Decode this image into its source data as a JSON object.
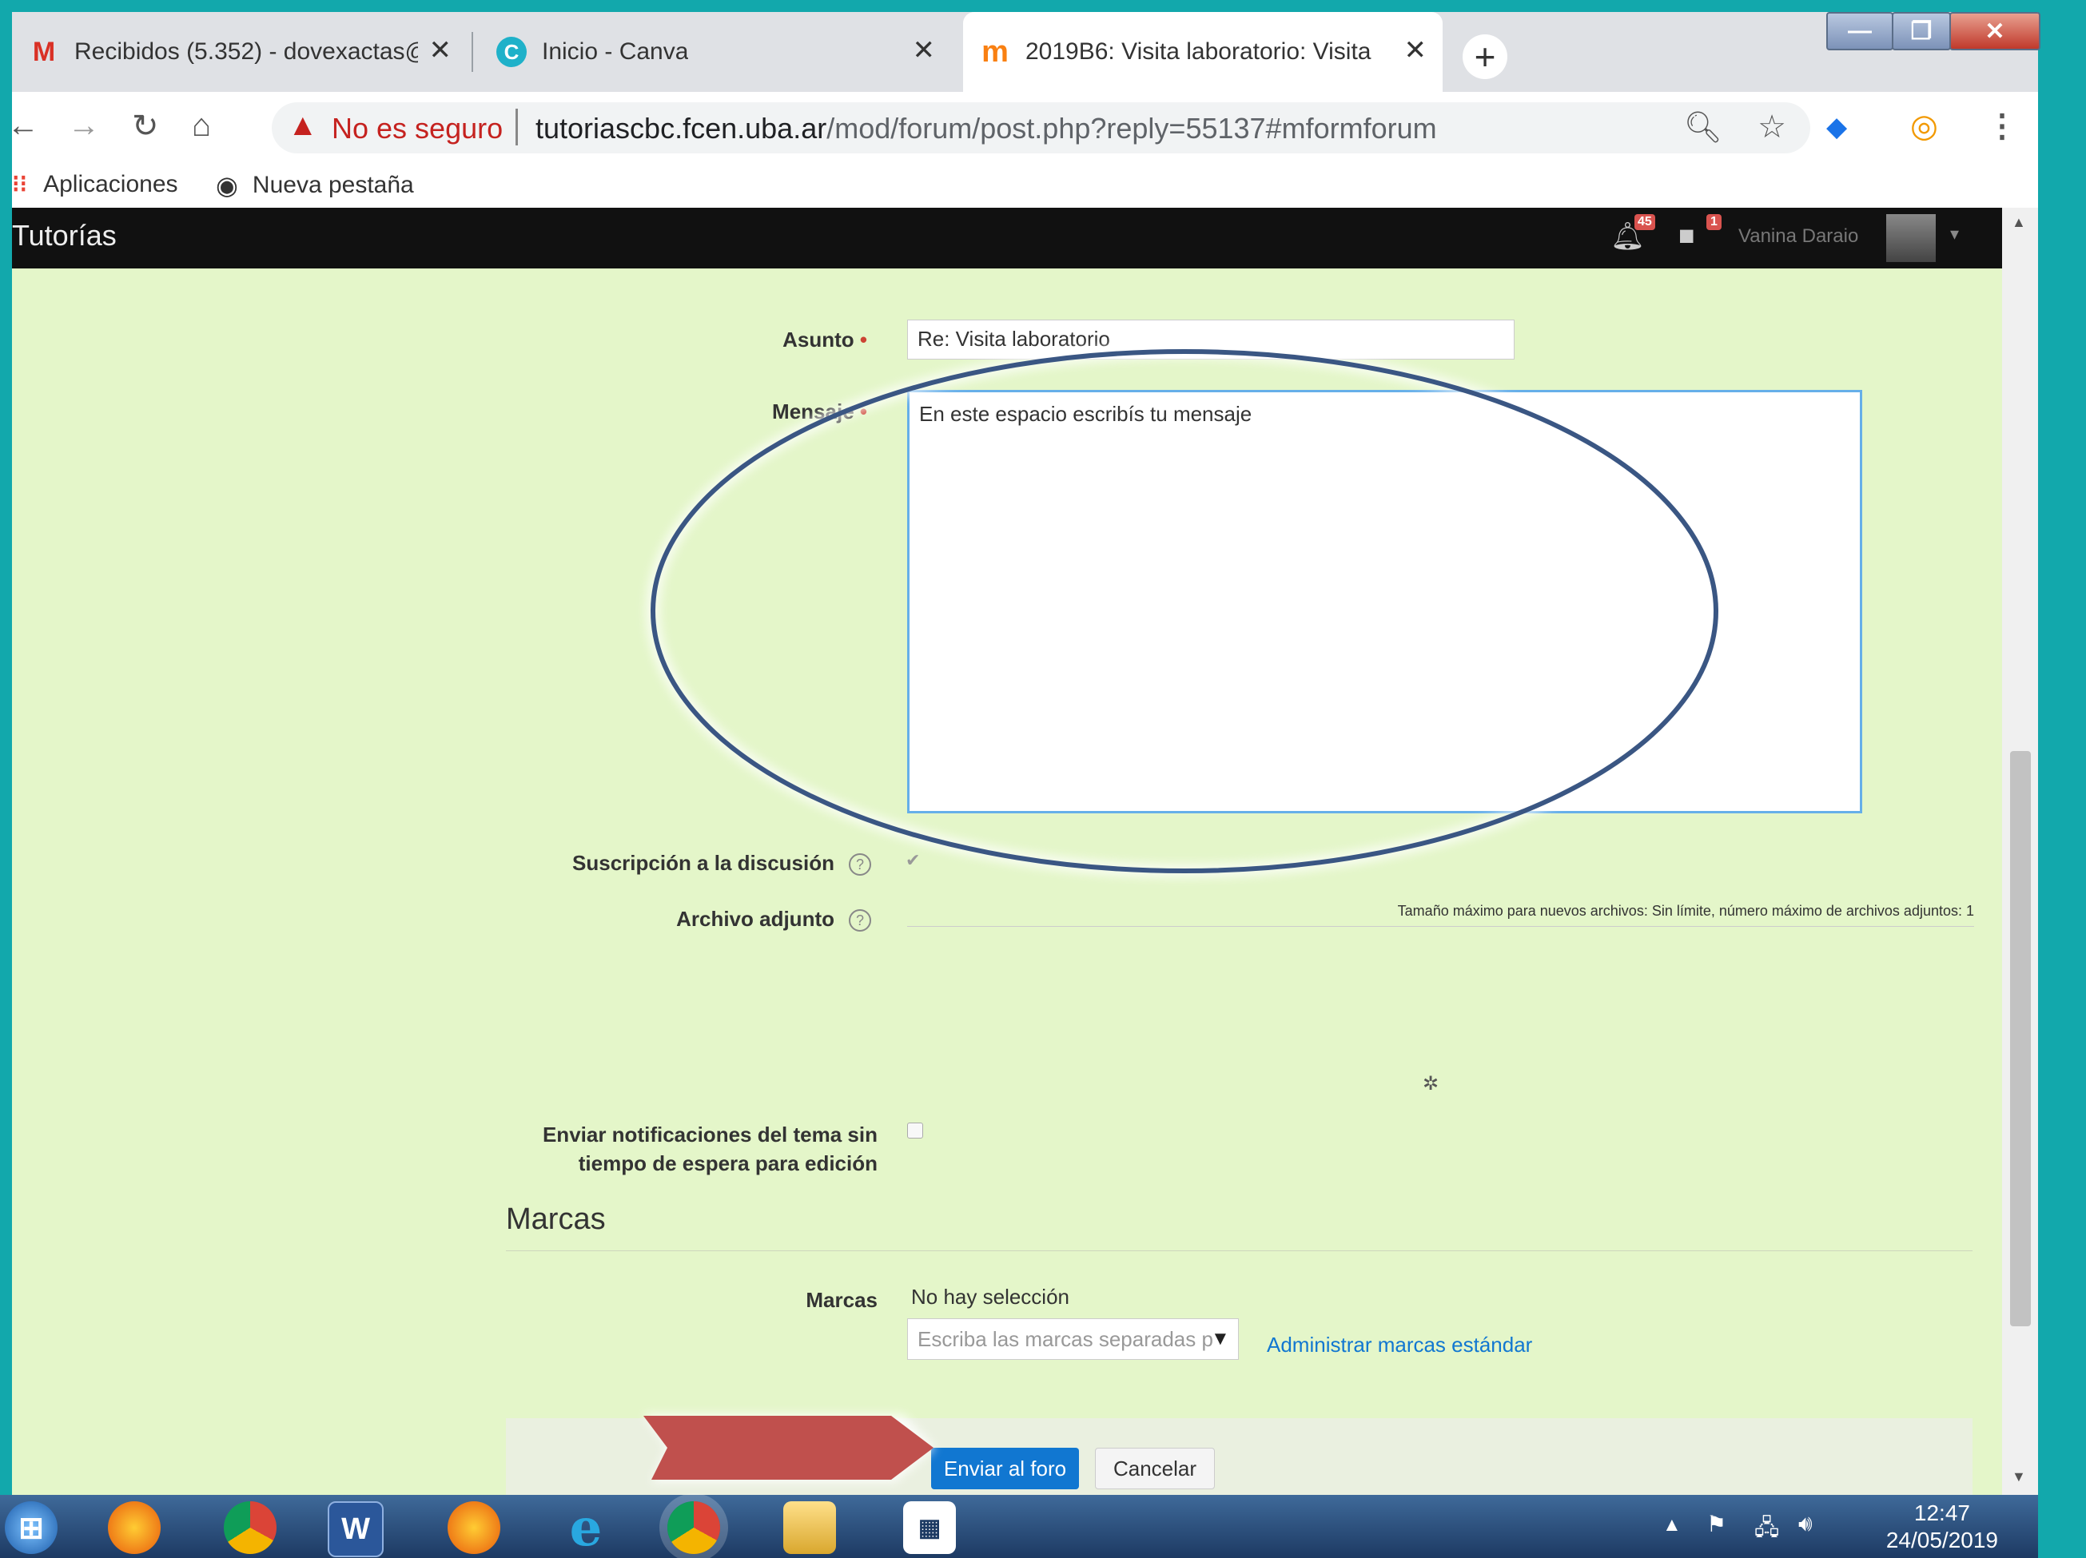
{
  "browser": {
    "tabs": [
      {
        "title": "Recibidos (5.352) - dovexactas@",
        "favicon": "gmail-icon",
        "close": "✕"
      },
      {
        "title": "Inicio - Canva",
        "favicon": "canva-icon",
        "close": "✕"
      },
      {
        "title": "2019B6: Visita laboratorio: Visita",
        "favicon": "moodle-icon",
        "close": "✕"
      }
    ],
    "new_tab": "+",
    "window_controls": {
      "minimize": "—",
      "maximize": "❐",
      "close": "✕"
    },
    "security_label": "No es seguro",
    "url_host": "tutoriascbc.fcen.uba.ar",
    "url_path": "/mod/forum/post.php?reply=55137#mformforum",
    "bookmarks": [
      "Aplicaciones",
      "Nueva pestaña"
    ]
  },
  "site": {
    "brand": "Tutorías",
    "notifications_count": "45",
    "messages_count": "1",
    "user_name": "Vanina Daraio"
  },
  "form": {
    "subject_label": "Asunto",
    "subject_value": "Re: Visita laboratorio",
    "message_label": "Mensaje",
    "message_value": "En este espacio escribís tu mensaje",
    "subscription_label": "Suscripción a la discusión",
    "subscription_checked": true,
    "attachment_label": "Archivo adjunto",
    "attachment_info": "Tamaño máximo para nuevos archivos: Sin límite, número máximo de archivos adjuntos: 1",
    "notify_label_1": "Enviar notificaciones del tema sin",
    "notify_label_2": "tiempo de espera para edición",
    "notify_checked": false,
    "tags_section": "Marcas",
    "tags_label": "Marcas",
    "tags_selection": "No hay selección",
    "tags_placeholder": "Escriba las marcas separadas p",
    "manage_tags": "Administrar marcas estándar",
    "submit": "Enviar al foro",
    "cancel": "Cancelar"
  },
  "annotation": {
    "ellipse_color": "#3a5683",
    "arrow_color": "#c0504d"
  },
  "taskbar": {
    "time": "12:47",
    "date": "24/05/2019"
  },
  "colors": {
    "page_bg": "#e4f6c9",
    "primary": "#1177d1",
    "frame": "#12a8ac"
  }
}
